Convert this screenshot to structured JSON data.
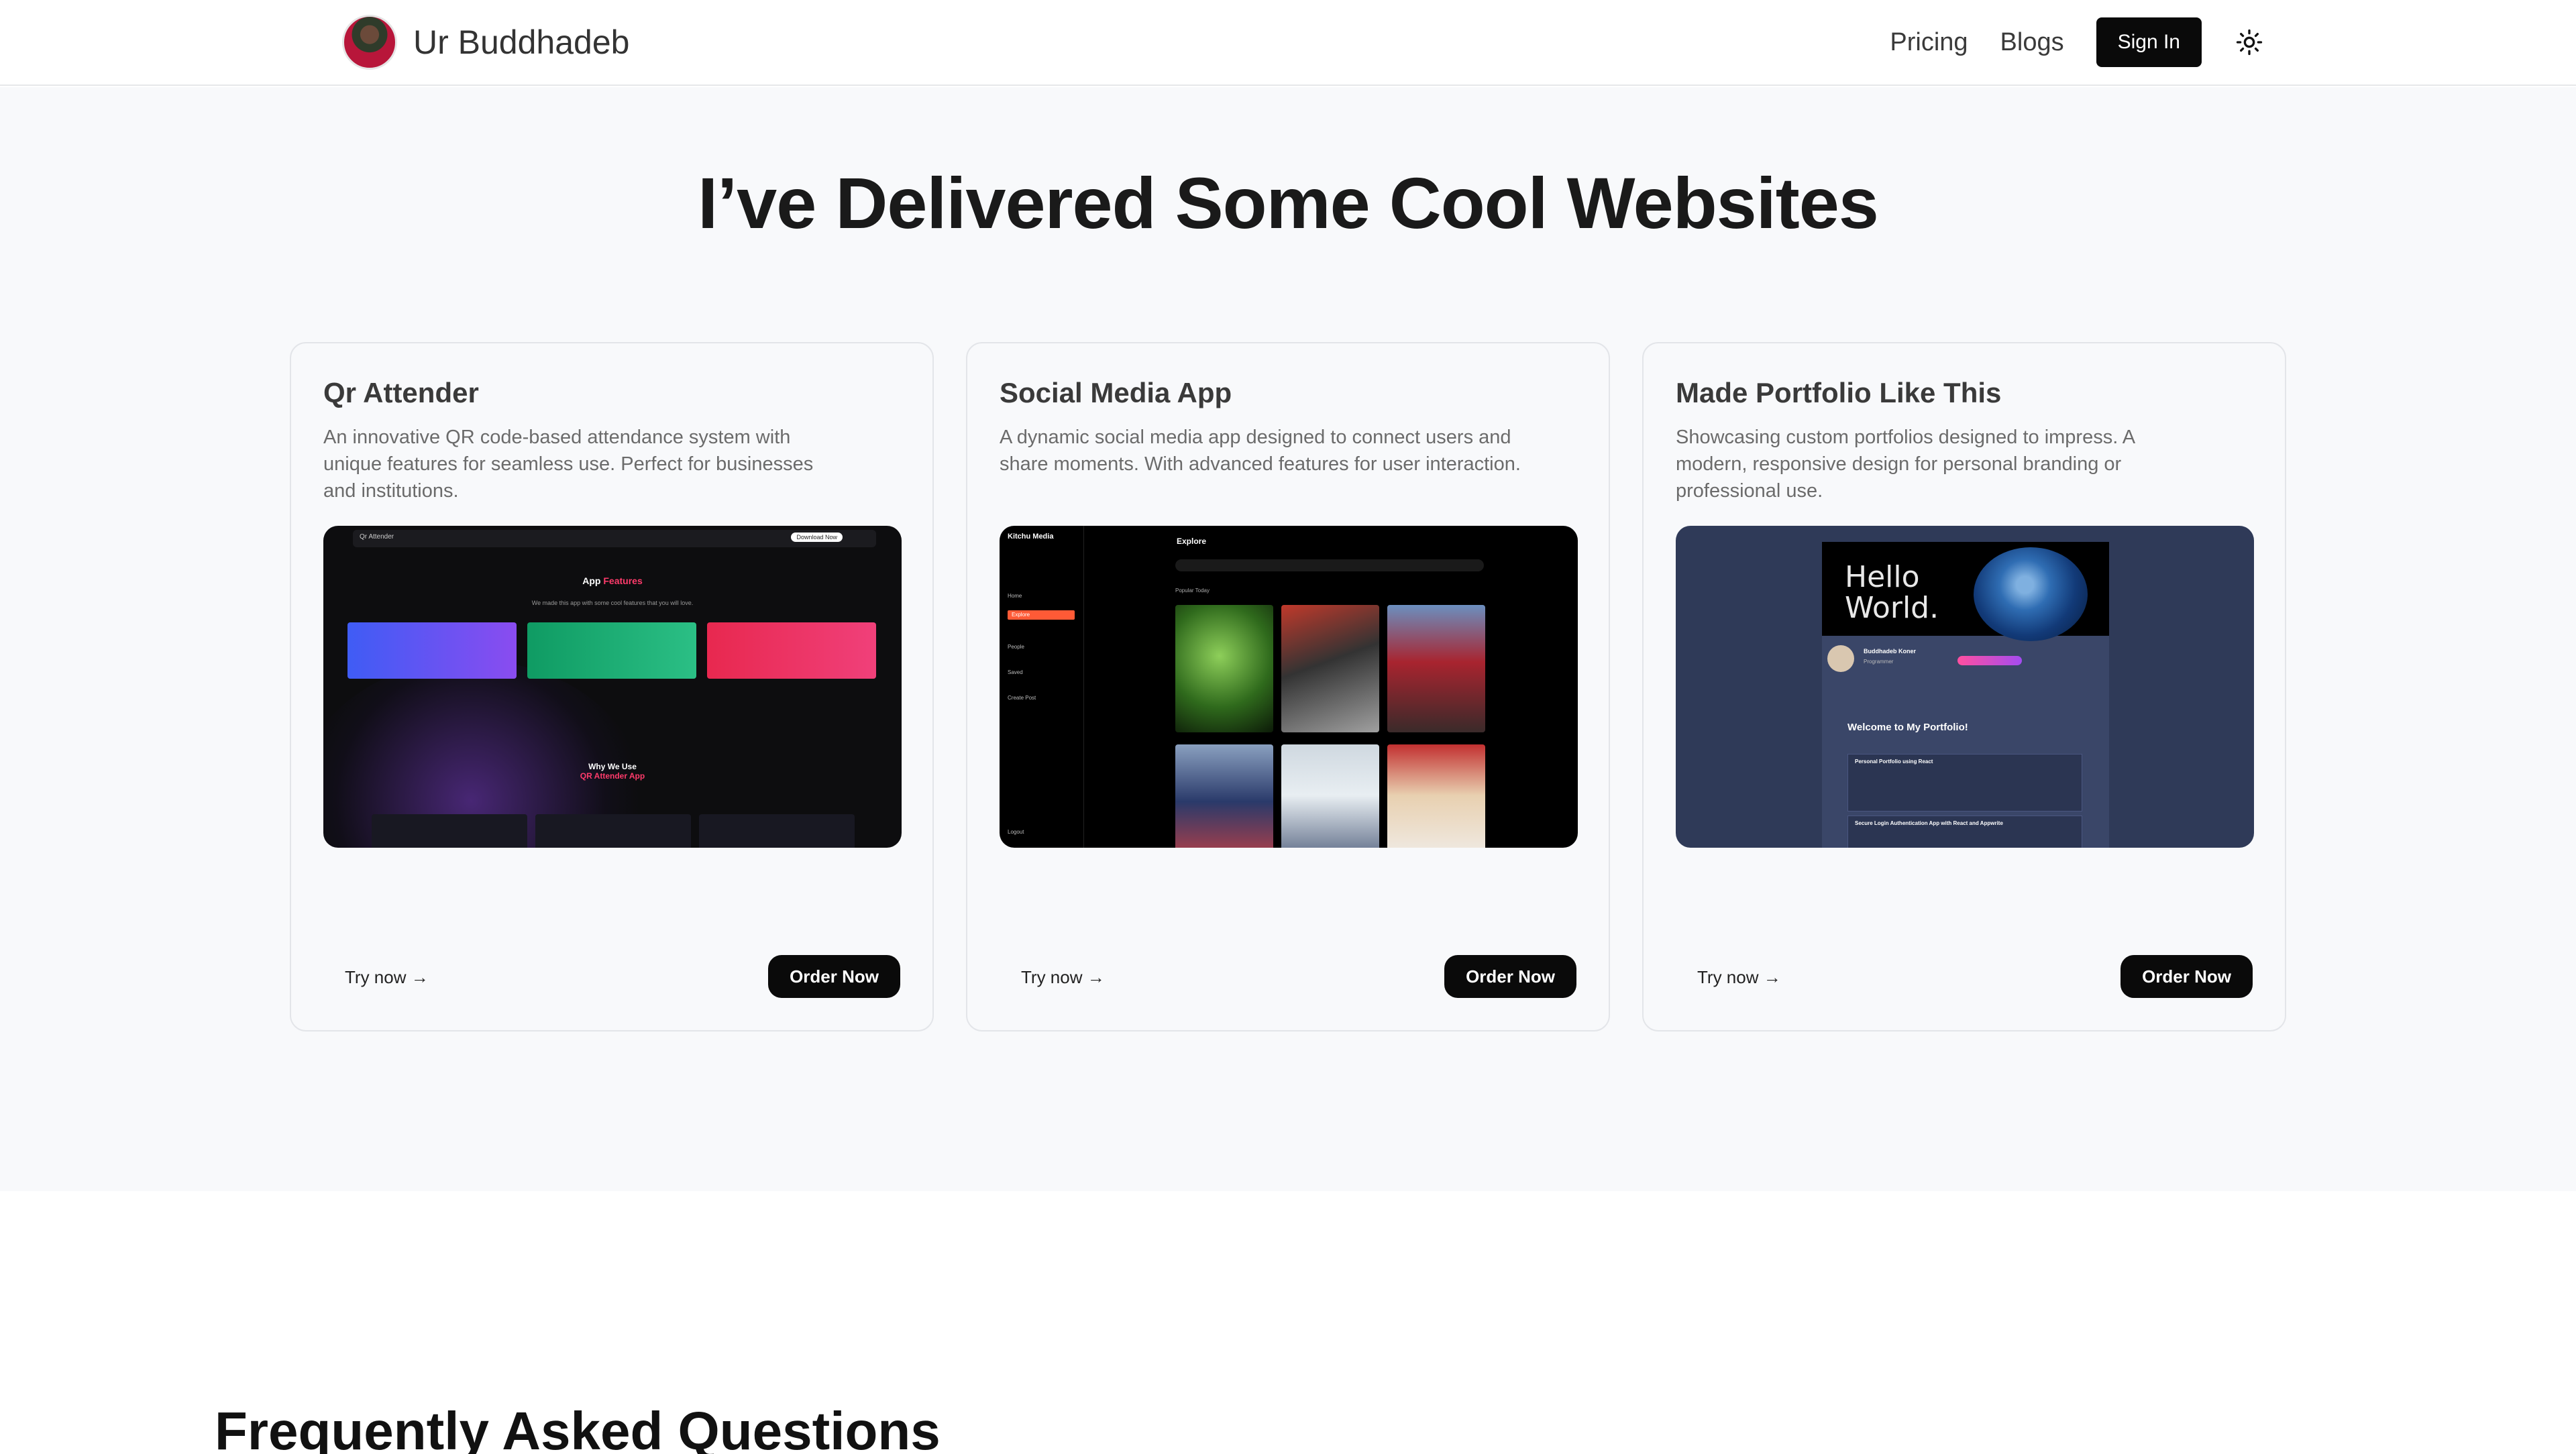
{
  "header": {
    "brand_name": "Ur Buddhadeb",
    "nav": [
      "Pricing",
      "Blogs"
    ],
    "signin_label": "Sign In"
  },
  "projects": {
    "title": "I’ve Delivered Some Cool Websites",
    "cards": [
      {
        "title": "Qr Attender",
        "description": "An innovative QR code-based attendance system with unique features for seamless use. Perfect for businesses and institutions.",
        "try_label": "Try now →",
        "order_label": "Order Now",
        "preview": {
          "app_name": "Qr Attender",
          "download_label": "Download Now",
          "heading_plain": "App",
          "heading_accent": "Features",
          "subheading": "We made this app with some cool features that you will love.",
          "why_title": "Why We Use",
          "why_accent": "QR Attender App"
        }
      },
      {
        "title": "Social Media App",
        "description": "A dynamic social media app designed to connect users and share moments. With advanced features for user interaction.",
        "try_label": "Try now →",
        "order_label": "Order Now",
        "preview": {
          "app_name": "Kitchu Media",
          "page_title": "Explore",
          "nav_items": [
            "Home",
            "Explore",
            "People",
            "Saved",
            "Create Post"
          ],
          "section": "Popular Today",
          "logout": "Logout"
        }
      },
      {
        "title": "Made Portfolio Like This",
        "description": "Showcasing custom portfolios designed to impress. A modern, responsive design for personal branding or professional use.",
        "try_label": "Try now →",
        "order_label": "Order Now",
        "preview": {
          "hero_text": "Hello World.",
          "profile_name": "Buddhadeb Koner",
          "profile_role": "Programmer",
          "welcome": "Welcome to My Portfolio!",
          "items": [
            "Personal Portfolio using React",
            "Secure Login Authentication App with React and Appwrite"
          ]
        }
      }
    ]
  },
  "faq": {
    "title": "Frequently Asked Questions"
  },
  "colors": {
    "accent_dark": "#0a0a0a",
    "section_bg": "#f8f9fb",
    "feature_blue": "#4a5cf0",
    "feature_green": "#12a36a",
    "feature_red": "#ef2f5c",
    "portfolio_bg": "#2f3a58",
    "social_accent": "#ff5a36"
  },
  "icons": {
    "theme_toggle": "sun-icon"
  }
}
